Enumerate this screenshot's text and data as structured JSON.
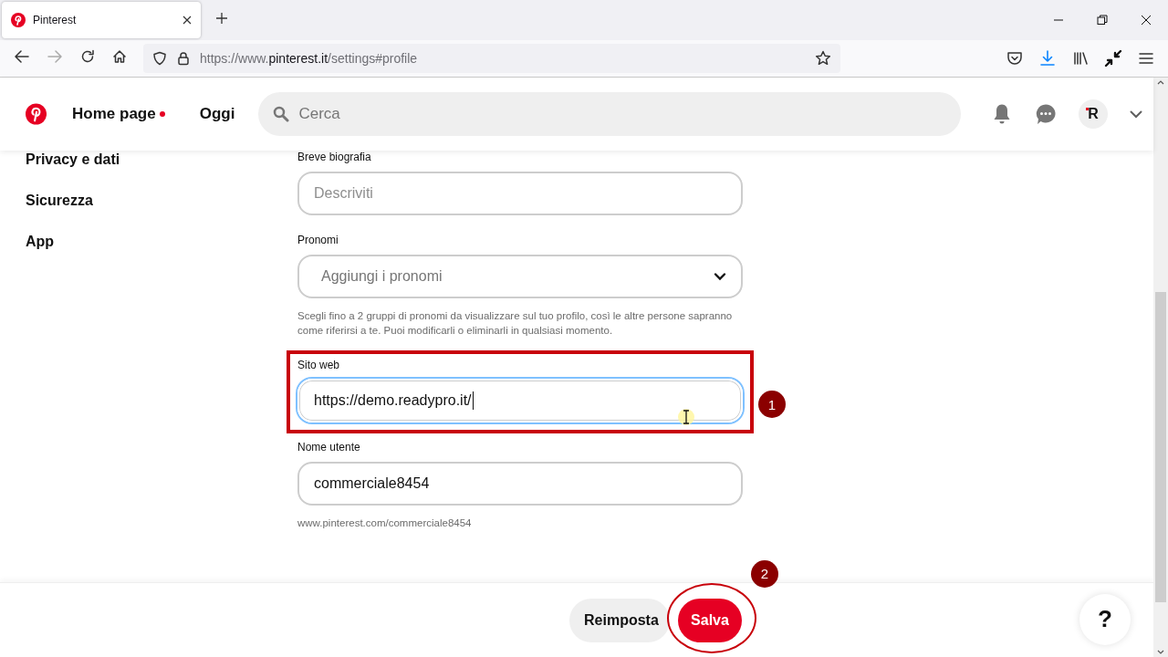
{
  "browser": {
    "tab": {
      "title": "Pinterest"
    },
    "url": {
      "scheme": "https://www.",
      "domain": "pinterest.it",
      "path": "/settings#profile"
    }
  },
  "header": {
    "nav": [
      {
        "label": "Home page",
        "dot": true
      },
      {
        "label": "Oggi",
        "dot": false
      }
    ],
    "search": {
      "placeholder": "Cerca"
    },
    "avatar_initial": "R"
  },
  "sidebar": {
    "items": [
      {
        "label": "Privacy e dati"
      },
      {
        "label": "Sicurezza"
      },
      {
        "label": "App"
      }
    ]
  },
  "form": {
    "fields": [
      {
        "kind": "text",
        "label": "Breve biografia",
        "placeholder": "Descriviti",
        "focused": false
      },
      {
        "kind": "select",
        "label": "Pronomi",
        "placeholder": "Aggiungi i pronomi",
        "focused": false,
        "help": "Scegli fino a 2 gruppi di pronomi da visualizzare sul tuo profilo, così le altre persone sapranno come riferirsi a te. Puoi modificarli o eliminarli in qualsiasi momento."
      },
      {
        "kind": "text",
        "label": "Sito web",
        "value": "https://demo.readypro.it/",
        "focused": true,
        "annotation": "1"
      },
      {
        "kind": "text",
        "label": "Nome utente",
        "value": "commerciale8454",
        "focused": false,
        "help": "www.pinterest.com/commerciale8454"
      }
    ]
  },
  "actions": {
    "buttons": [
      {
        "label": "Reimposta",
        "kind": "secondary"
      },
      {
        "label": "Salva",
        "kind": "primary",
        "annotation": "2"
      }
    ],
    "help": "?"
  }
}
